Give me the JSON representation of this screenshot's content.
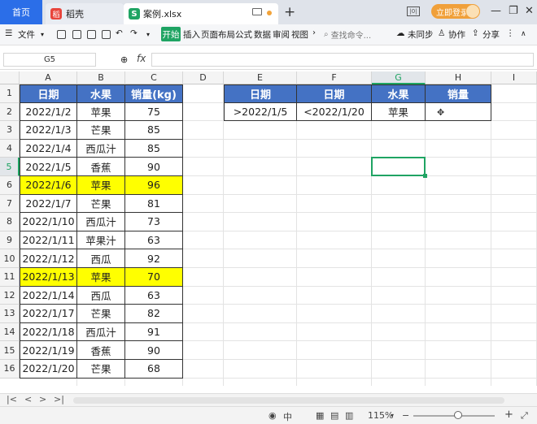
{
  "titlebar": {
    "home_tab": "首页",
    "app_tab": "稻壳",
    "app_logo": "稻",
    "file_tab": "案例.xlsx",
    "file_logo": "S",
    "login_label": "立即登录",
    "icons": [
      "monitor-icon",
      "close-icon",
      "plus-icon",
      "grid-icon",
      "minimize-icon",
      "maximize-icon",
      "close-window-icon"
    ]
  },
  "toolbar": {
    "menu_label": "文件",
    "start_label": "开始",
    "tabs": [
      "插入",
      "页面布局",
      "公式",
      "数据",
      "审阅",
      "视图"
    ],
    "search_placeholder": "查找命令...",
    "sync_label": "未同步",
    "collab_label": "协作",
    "share_label": "分享"
  },
  "formula_bar": {
    "cell_ref": "G5",
    "fx_label": "fx",
    "value": ""
  },
  "grid": {
    "columns": [
      "A",
      "B",
      "C",
      "D",
      "E",
      "F",
      "G",
      "H",
      "I"
    ],
    "rows": [
      "1",
      "2",
      "3",
      "4",
      "5",
      "6",
      "7",
      "8",
      "9",
      "10",
      "11",
      "12",
      "13",
      "14",
      "15",
      "16"
    ],
    "selected_column": "G",
    "selected_row": "5"
  },
  "table": {
    "headers": [
      "日期",
      "水果",
      "销量(kg)"
    ],
    "rows": [
      {
        "date": "2022/1/2",
        "fruit": "苹果",
        "qty": "75",
        "hl": false
      },
      {
        "date": "2022/1/3",
        "fruit": "芒果",
        "qty": "85",
        "hl": false
      },
      {
        "date": "2022/1/4",
        "fruit": "西瓜汁",
        "qty": "85",
        "hl": false
      },
      {
        "date": "2022/1/5",
        "fruit": "香蕉",
        "qty": "90",
        "hl": false
      },
      {
        "date": "2022/1/6",
        "fruit": "苹果",
        "qty": "96",
        "hl": true
      },
      {
        "date": "2022/1/7",
        "fruit": "芒果",
        "qty": "81",
        "hl": false
      },
      {
        "date": "2022/1/10",
        "fruit": "西瓜汁",
        "qty": "73",
        "hl": false
      },
      {
        "date": "2022/1/11",
        "fruit": "苹果汁",
        "qty": "63",
        "hl": false
      },
      {
        "date": "2022/1/12",
        "fruit": "西瓜",
        "qty": "92",
        "hl": false
      },
      {
        "date": "2022/1/13",
        "fruit": "苹果",
        "qty": "70",
        "hl": true
      },
      {
        "date": "2022/1/14",
        "fruit": "西瓜",
        "qty": "63",
        "hl": false
      },
      {
        "date": "2022/1/17",
        "fruit": "芒果",
        "qty": "82",
        "hl": false
      },
      {
        "date": "2022/1/18",
        "fruit": "西瓜汁",
        "qty": "91",
        "hl": false
      },
      {
        "date": "2022/1/19",
        "fruit": "香蕉",
        "qty": "90",
        "hl": false
      },
      {
        "date": "2022/1/20",
        "fruit": "芒果",
        "qty": "68",
        "hl": false
      }
    ],
    "highlight_color": "#ffff00",
    "header_color": "#4472c4"
  },
  "criteria": {
    "headers": [
      "日期",
      "日期",
      "水果",
      "销量"
    ],
    "values": [
      ">2022/1/5",
      "<2022/1/20",
      "苹果",
      ""
    ]
  },
  "sheet_nav": {
    "buttons": [
      "|<",
      "<",
      ">",
      ">|"
    ]
  },
  "statusbar": {
    "zoom_label": "115%",
    "zoom_level_pct": 115,
    "minus": "−",
    "plus": "+"
  }
}
